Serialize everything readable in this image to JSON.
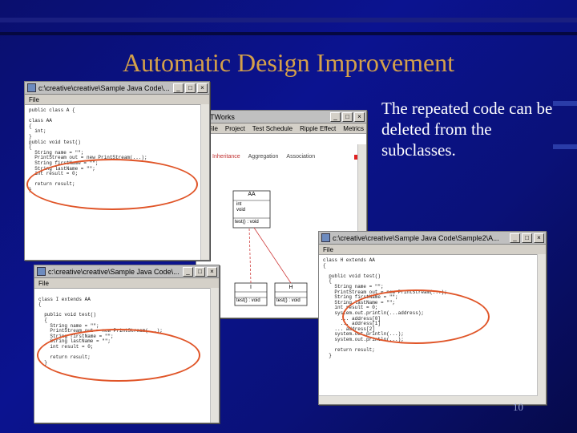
{
  "slide": {
    "title": "Automatic Design Improvement",
    "body_text": "The repeated code can be deleted from the subclasses.",
    "page_number": "10",
    "highlight_color": "#e05528",
    "title_color": "#d4a04a"
  },
  "window_top_left": {
    "title": "c:\\creative\\creative\\Sample Java Code\\...",
    "menu": [
      "File"
    ],
    "code_lines": [
      "public class A {",
      "",
      "class AA",
      "{",
      "  int;",
      "}",
      "public void test()",
      "{",
      "  String name = \"\";",
      "  PrintStream out = new PrintStream(...);",
      "  String firstName = \"\";",
      "  String lastName = \"\";",
      "  int result = 0;",
      "",
      "  return result;",
      "}"
    ]
  },
  "window_ootworks": {
    "title": "OOTWorks",
    "menu": [
      "File",
      "Project",
      "Test Schedule",
      "Ripple Effect",
      "Metrics"
    ],
    "toolbar": [
      "Inheritance",
      "Aggregation",
      "Association"
    ],
    "uml": {
      "parent_class": "AA",
      "parent_fields": [
        "int",
        "void"
      ],
      "parent_method": "test() : void",
      "child_left": "I",
      "child_right": "H",
      "child_left_method": "test() : void",
      "child_right_method": "test() : void"
    }
  },
  "window_bottom_left": {
    "title": "c:\\creative\\creative\\Sample Java Code\\...",
    "menu": [
      "File"
    ],
    "code_lines": [
      "",
      "class I extends AA",
      "{",
      "",
      "  public void test()",
      "  {",
      "    String name = \"\";",
      "    PrintStream out = new PrintStream(...);",
      "    String firstName = \"\";",
      "    String lastName = \"\";",
      "    int result = 0;",
      "",
      "    return result;",
      "  }"
    ]
  },
  "window_right": {
    "title": "c:\\creative\\creative\\Sample Java Code\\Sample2\\A...",
    "menu": [
      "File"
    ],
    "code_lines": [
      "class H extends AA",
      "{",
      "",
      "  public void test()",
      "  {",
      "    String name = \"\";",
      "    PrintStream out = new PrintStream(...);",
      "    String firstName = \"\";",
      "    String lastName = \"\";",
      "    int result = 0;",
      "    system.out.println(...address);",
      "      ... address[0]",
      "      ... address[1]",
      "    ... address[2]",
      "    system.out.println(...);",
      "    system.out.println(...);",
      "",
      "    return result;",
      "  }"
    ]
  }
}
